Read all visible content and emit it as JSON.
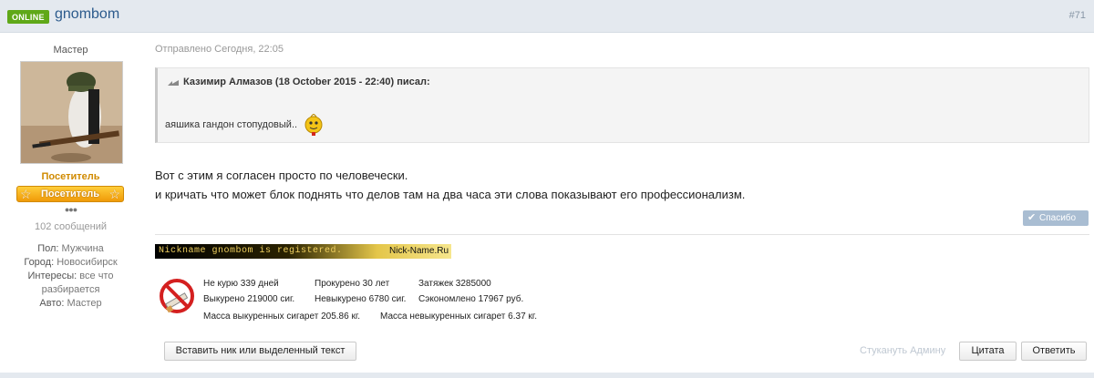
{
  "header": {
    "online": "ONLINE",
    "username": "gnombom",
    "post_number": "#71"
  },
  "author": {
    "rank": "Мастер",
    "group": "Посетитель",
    "badge": "Посетитель",
    "pips": "●●●",
    "posts": "102 сообщений",
    "profile": [
      {
        "key": "Пол:",
        "value": "Мужчина"
      },
      {
        "key": "Город:",
        "value": "Новосибирск"
      },
      {
        "key": "Интересы:",
        "value": "все что разбирается"
      },
      {
        "key": "Авто:",
        "value": "Мастер"
      }
    ]
  },
  "post": {
    "sent": "Отправлено Сегодня, 22:05",
    "quote_header": "Казимир Алмазов (18 October 2015 - 22:40) писал:",
    "quote_text": "аяшика гандон стопудовый..",
    "line1": "Вот с этим я согласен просто по человечески.",
    "line2": "и кричать что может блок поднять что делов там на два часа эти слова показывают его профессионализм.",
    "thanks": "Спасибо"
  },
  "signature": {
    "nick_left": "Nickname gnombom is registered.",
    "nick_right": "Nick-Name.Ru",
    "smoke": [
      [
        "Не курю 339 дней",
        "Прокурено 30 лет",
        "Затяжек 3285000"
      ],
      [
        "Выкурено 219000 сиг.",
        "Невыкурено 6780 сиг.",
        "Сэкономлено 17967 руб."
      ],
      [
        "Масса выкуренных сигарет 205.86 кг.",
        "Масса невыкуренных сигарет 6.37 кг."
      ]
    ]
  },
  "actions": {
    "insert_nick": "Вставить ник или выделенный текст",
    "report": "Стукануть Админу",
    "quote": "Цитата",
    "reply": "Ответить"
  },
  "colors": {
    "online": "#5fa818",
    "username": "#2b5a8c",
    "badge": "#f0a010",
    "thanks": "#a9bdd2"
  }
}
